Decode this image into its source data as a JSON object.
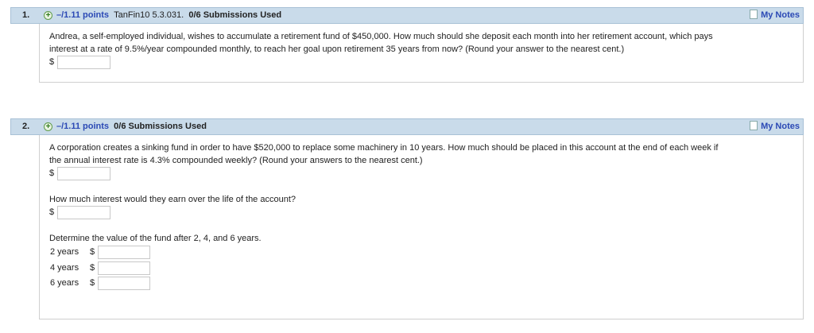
{
  "q1": {
    "number": "1.",
    "points": "–/1.11 points",
    "id": "TanFin10 5.3.031.",
    "submissions": "0/6 Submissions Used",
    "notes": "My Notes",
    "line1": "Andrea, a self-employed individual, wishes to accumulate a retirement fund of $450,000. How much should she deposit each month into her retirement account, which pays",
    "line2": "interest at a rate of 9.5%/year compounded monthly, to reach her goal upon retirement 35 years from now? (Round your answer to the nearest cent.)",
    "currency": "$"
  },
  "q2": {
    "number": "2.",
    "points": "–/1.11 points",
    "submissions": "0/6 Submissions Used",
    "notes": "My Notes",
    "line1": "A corporation creates a sinking fund in order to have $520,000 to replace some machinery in 10 years. How much should be placed in this account at the end of each week if",
    "line2": "the annual interest rate is 4.3% compounded weekly? (Round your answers to the nearest cent.)",
    "currency": "$",
    "interest_q": "How much interest would they earn over the life of the account?",
    "value_q": "Determine the value of the fund after 2, 4, and 6 years.",
    "years": [
      "2 years",
      "4 years",
      "6 years"
    ]
  }
}
